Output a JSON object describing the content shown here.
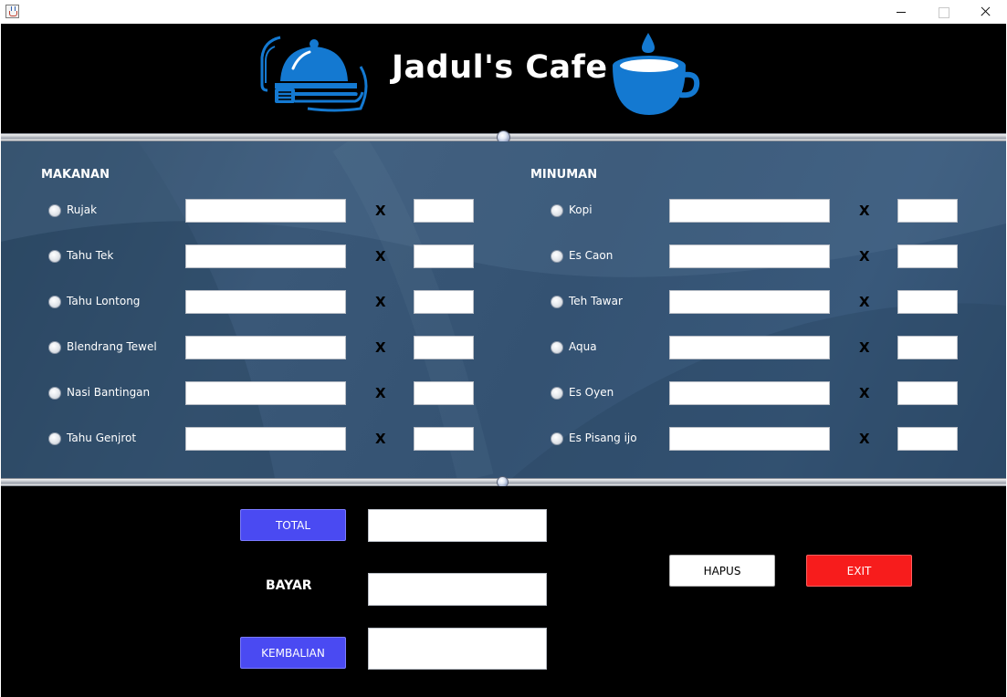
{
  "window": {
    "title": "",
    "controls": [
      "minimize",
      "maximize",
      "close"
    ]
  },
  "header": {
    "title": "Jadul's Cafe",
    "left_logo_icon": "food-cloche-icon",
    "right_logo_icon": "coffee-cup-icon",
    "accent_color": "#1479d1"
  },
  "makanan": {
    "label": "MAKANAN",
    "items": [
      {
        "name": "Rujak",
        "price": "",
        "qty": ""
      },
      {
        "name": "Tahu Tek",
        "price": "",
        "qty": ""
      },
      {
        "name": "Tahu Lontong",
        "price": "",
        "qty": ""
      },
      {
        "name": "Blendrang Tewel",
        "price": "",
        "qty": ""
      },
      {
        "name": "Nasi Bantingan",
        "price": "",
        "qty": ""
      },
      {
        "name": "Tahu Genjrot",
        "price": "",
        "qty": ""
      }
    ]
  },
  "minuman": {
    "label": "MINUMAN",
    "items": [
      {
        "name": "Kopi",
        "price": "",
        "qty": ""
      },
      {
        "name": "Es Caon",
        "price": "",
        "qty": ""
      },
      {
        "name": "Teh Tawar",
        "price": "",
        "qty": ""
      },
      {
        "name": "Aqua",
        "price": "",
        "qty": ""
      },
      {
        "name": "Es Oyen",
        "price": "",
        "qty": ""
      },
      {
        "name": "Es Pisang ijo",
        "price": "",
        "qty": ""
      }
    ]
  },
  "times_symbol": "X",
  "bottom": {
    "total_label": "TOTAL",
    "total_value": "",
    "bayar_label": "BAYAR",
    "bayar_value": "",
    "kembalian_label": "KEMBALIAN",
    "kembalian_value": "",
    "hapus_label": "HAPUS",
    "exit_label": "EXIT"
  },
  "colors": {
    "primary_button": "#4a4af2",
    "exit_button": "#f71c1c",
    "panel_background": "#365474"
  }
}
